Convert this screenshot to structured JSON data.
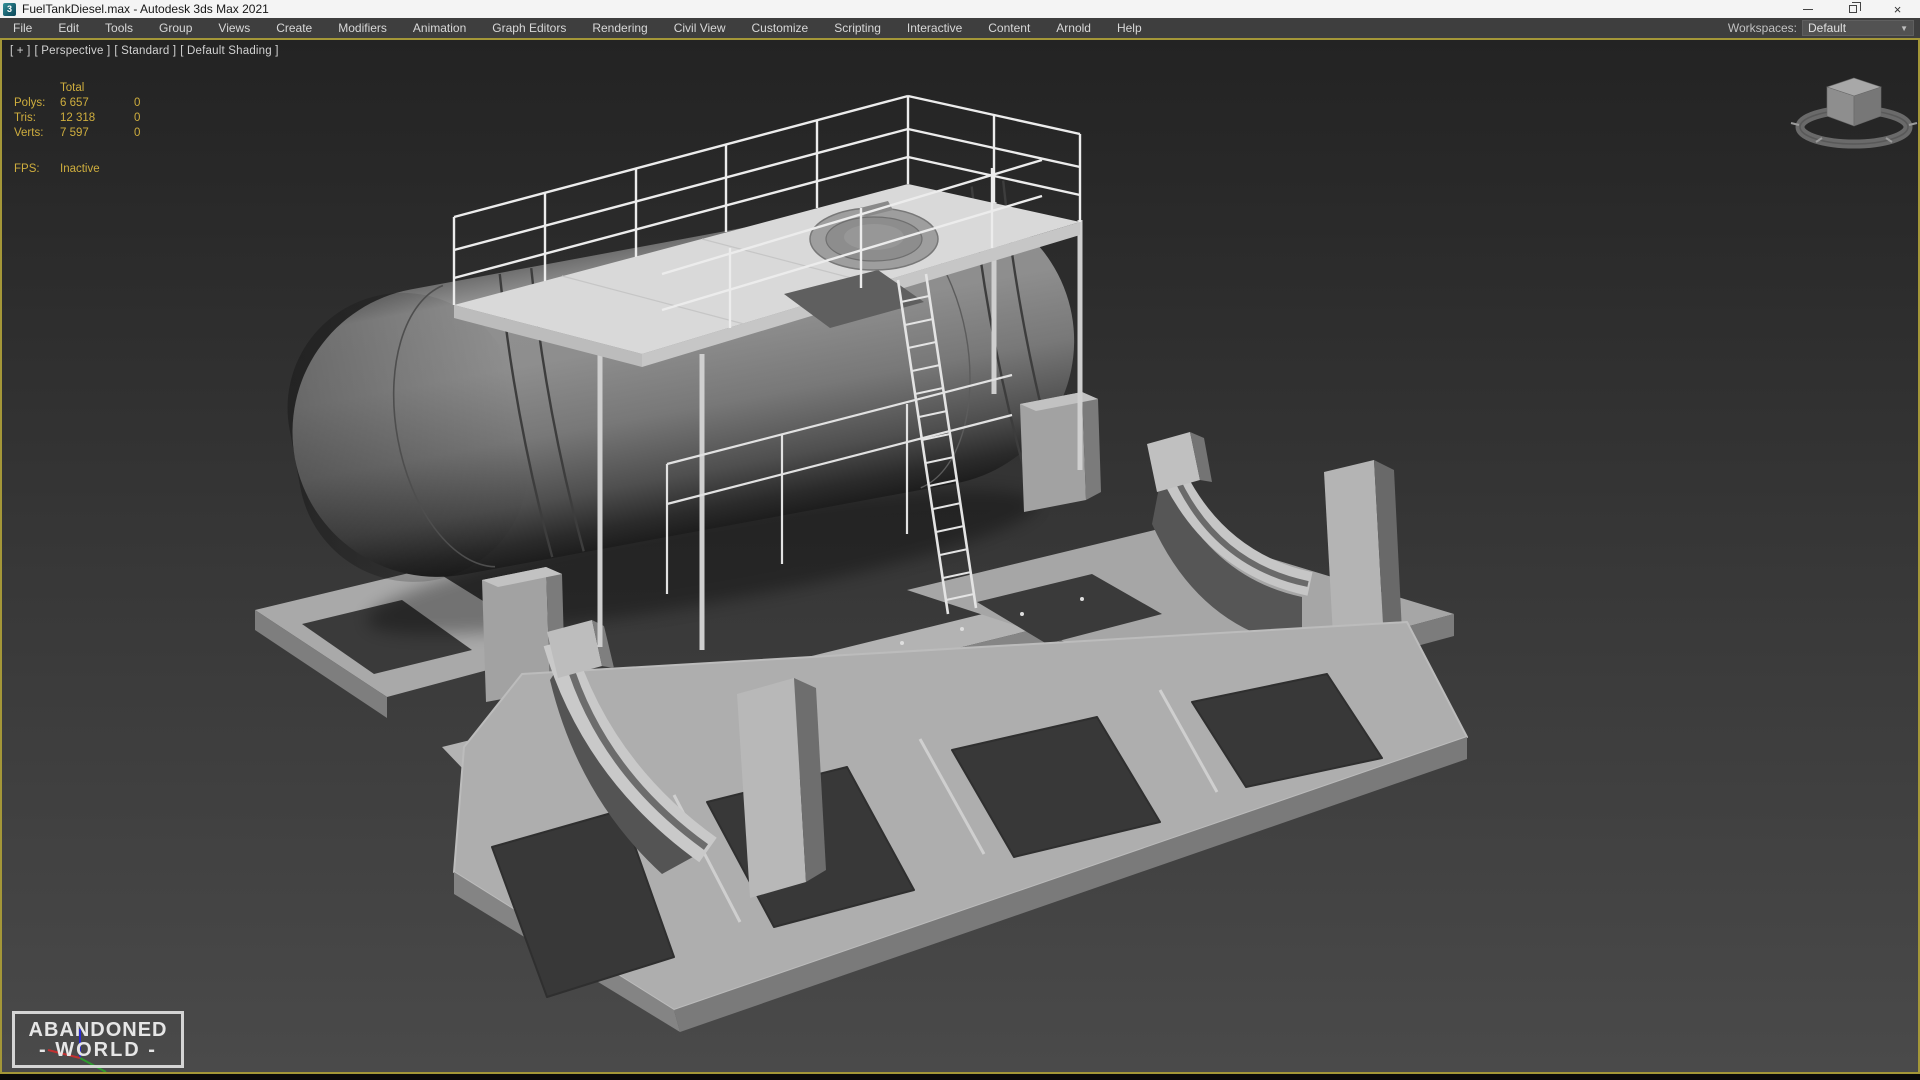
{
  "window": {
    "title": "FuelTankDiesel.max - Autodesk 3ds Max 2021",
    "app_icon_glyph": "3",
    "controls": {
      "minimize": "minimize",
      "restore": "restore",
      "close": "×"
    }
  },
  "menu": {
    "items": [
      "File",
      "Edit",
      "Tools",
      "Group",
      "Views",
      "Create",
      "Modifiers",
      "Animation",
      "Graph Editors",
      "Rendering",
      "Civil View",
      "Customize",
      "Scripting",
      "Interactive",
      "Content",
      "Arnold",
      "Help"
    ],
    "workspaces_label": "Workspaces:",
    "workspaces_value": "Default",
    "workspaces_arrow": "▼"
  },
  "viewport": {
    "label_segments": {
      "pom": "[ + ]",
      "view": "[ Perspective ]",
      "renderer": "[ Standard ]",
      "shading": "[ Default Shading ]"
    },
    "statistics": {
      "header": "Total",
      "rows": [
        {
          "label": "Polys:",
          "value": "6 657",
          "second": "0"
        },
        {
          "label": "Tris:",
          "value": "12 318",
          "second": "0"
        },
        {
          "label": "Verts:",
          "value": "7 597",
          "second": "0"
        }
      ],
      "fps_label": "FPS:",
      "fps_value": "Inactive"
    },
    "colors": {
      "stats_text": "#cfae3e",
      "active_border": "#a49738",
      "bg_top": "#252525",
      "bg_bottom": "#4a4a4a"
    },
    "scene_objects": [
      "fuel tank",
      "top platform with railing",
      "manhole cover",
      "access ladder",
      "tank straps",
      "support pedestals",
      "rear skid frame",
      "front skid frame",
      "saddle supports"
    ]
  },
  "watermark": {
    "line1": "ABANDONED",
    "line2": "- WORLD -"
  }
}
